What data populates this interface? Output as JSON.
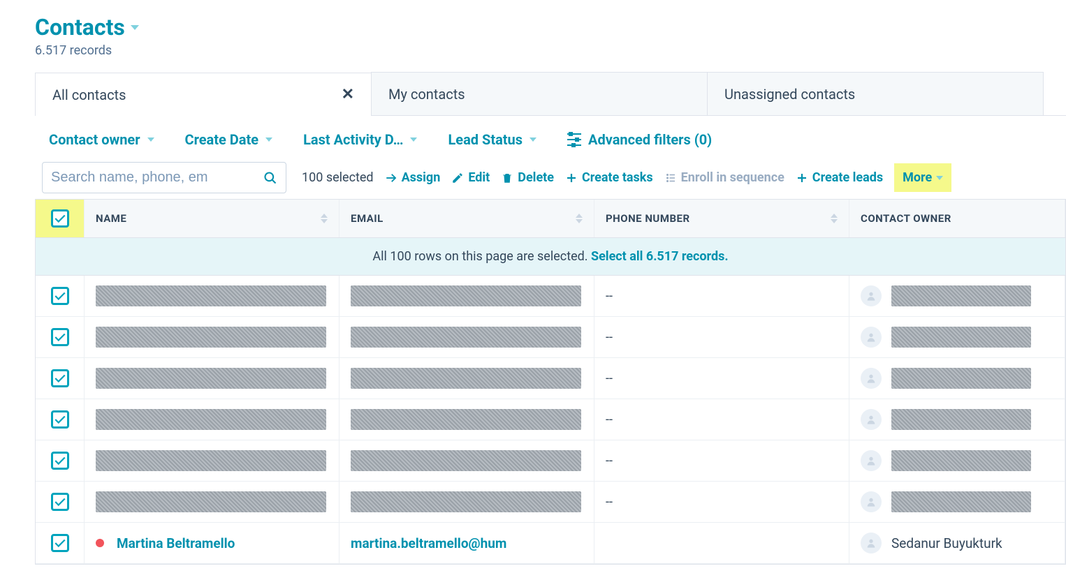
{
  "page": {
    "title": "Contacts",
    "record_count": "6.517 records"
  },
  "tabs": [
    {
      "label": "All contacts",
      "active": true,
      "closable": true
    },
    {
      "label": "My contacts",
      "active": false,
      "closable": false
    },
    {
      "label": "Unassigned contacts",
      "active": false,
      "closable": false
    }
  ],
  "filters": {
    "owner": "Contact owner",
    "create_date": "Create Date",
    "last_activity": "Last Activity D…",
    "lead_status": "Lead Status",
    "advanced": "Advanced filters (0)"
  },
  "search": {
    "placeholder": "Search name, phone, em"
  },
  "toolbar": {
    "selected_text": "100 selected",
    "assign": "Assign",
    "edit": "Edit",
    "delete": "Delete",
    "create_tasks": "Create tasks",
    "enroll": "Enroll in sequence",
    "create_leads": "Create leads",
    "more": "More"
  },
  "columns": {
    "name": "NAME",
    "email": "EMAIL",
    "phone": "PHONE NUMBER",
    "owner": "CONTACT OWNER"
  },
  "select_banner": {
    "prefix": "All 100 rows on this page are selected. ",
    "link": "Select all 6.517 records."
  },
  "rows": [
    {
      "redacted": true,
      "phone": "--"
    },
    {
      "redacted": true,
      "phone": "--"
    },
    {
      "redacted": true,
      "phone": "--"
    },
    {
      "redacted": true,
      "phone": "--"
    },
    {
      "redacted": true,
      "phone": "--"
    },
    {
      "redacted": true,
      "phone": "--"
    },
    {
      "redacted": false,
      "name": "Martina Beltramello",
      "email": "martina.beltramello@hum",
      "phone": "",
      "owner": "Sedanur Buyukturk"
    }
  ]
}
